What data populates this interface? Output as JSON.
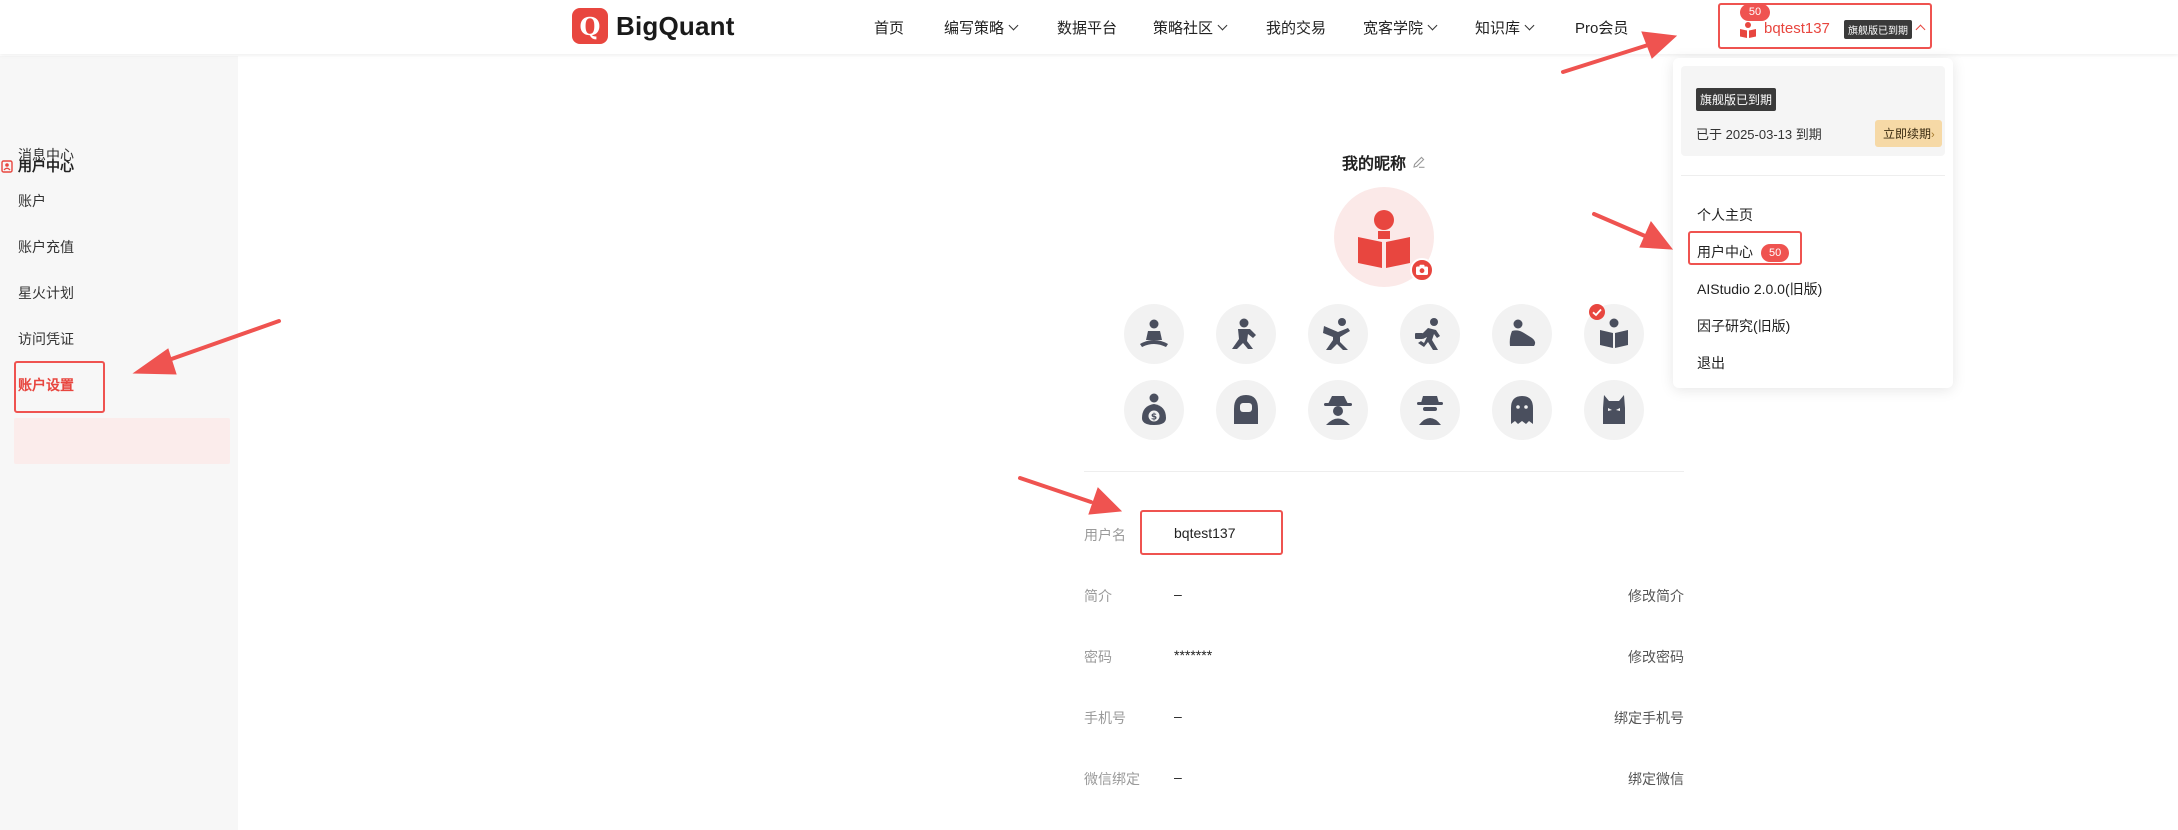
{
  "brand": {
    "name": "BigQuant",
    "logo_letter": "Q",
    "accent": "#e8463f"
  },
  "nav": [
    {
      "label": "首页",
      "dropdown": false
    },
    {
      "label": "编写策略",
      "dropdown": true
    },
    {
      "label": "数据平台",
      "dropdown": false
    },
    {
      "label": "策略社区",
      "dropdown": true
    },
    {
      "label": "我的交易",
      "dropdown": false
    },
    {
      "label": "宽客学院",
      "dropdown": true
    },
    {
      "label": "知识库",
      "dropdown": true
    },
    {
      "label": "Pro会员",
      "dropdown": false
    }
  ],
  "user": {
    "badge_count": "50",
    "name": "bqtest137",
    "expired_tag": "旗舰版已到期"
  },
  "sidebar": {
    "title": "用户中心",
    "items": [
      {
        "label": "消息中心"
      },
      {
        "label": "账户"
      },
      {
        "label": "账户充值"
      },
      {
        "label": "星火计划"
      },
      {
        "label": "访问凭证"
      },
      {
        "label": "账户设置",
        "active": true
      }
    ]
  },
  "profile": {
    "nickname_title": "我的昵称",
    "avatar_options": [
      "meditation-icon",
      "kungfu-icon",
      "martial-arts-icon",
      "runner-icon",
      "sumo-icon",
      "reader-icon",
      "money-bag-icon",
      "hooded-girl-icon",
      "spy-icon",
      "detective-icon",
      "ghost-icon",
      "devil-icon"
    ],
    "selected_avatar": "reader-icon",
    "fields": [
      {
        "label": "用户名",
        "value": "bqtest137",
        "action": ""
      },
      {
        "label": "简介",
        "value": "–",
        "action": "修改简介"
      },
      {
        "label": "密码",
        "value": "*******",
        "action": "修改密码"
      },
      {
        "label": "手机号",
        "value": "–",
        "action": "绑定手机号"
      },
      {
        "label": "微信绑定",
        "value": "–",
        "action": "绑定微信"
      }
    ]
  },
  "dropdown": {
    "expired_tag": "旗舰版已到期",
    "expire_text": "已于 2025-03-13 到期",
    "renew_label": "立即续期",
    "items": [
      {
        "label": "个人主页"
      },
      {
        "label": "用户中心",
        "badge": "50"
      },
      {
        "label": "AIStudio 2.0.0(旧版)"
      },
      {
        "label": "因子研究(旧版)"
      },
      {
        "label": "退出"
      }
    ]
  },
  "annotation_color": "#ef5350"
}
